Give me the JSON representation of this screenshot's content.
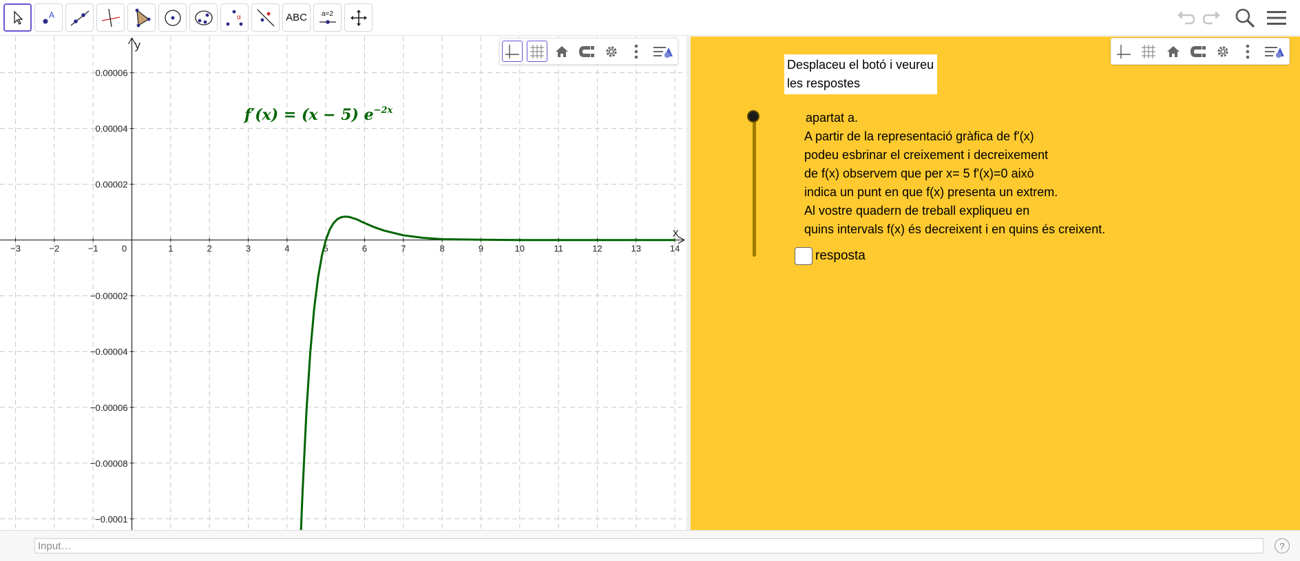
{
  "toolbar": {
    "tools": [
      {
        "name": "move-tool",
        "icon": "arrow-cursor-icon",
        "active": true
      },
      {
        "name": "point-tool",
        "icon": "point-icon"
      },
      {
        "name": "line-tool",
        "icon": "line-icon"
      },
      {
        "name": "perpendicular-line-tool",
        "icon": "perpendicular-icon"
      },
      {
        "name": "polygon-tool",
        "icon": "polygon-icon"
      },
      {
        "name": "circle-tool",
        "icon": "circle-icon"
      },
      {
        "name": "ellipse-tool",
        "icon": "ellipse-icon"
      },
      {
        "name": "angle-tool",
        "icon": "angle-icon"
      },
      {
        "name": "reflect-tool",
        "icon": "reflect-icon"
      },
      {
        "name": "text-tool",
        "icon": "text-icon",
        "label": "ABC"
      },
      {
        "name": "slider-tool",
        "icon": "slider-icon",
        "label": "a = 2"
      },
      {
        "name": "move-graphics-tool",
        "icon": "move-graphics-icon"
      }
    ],
    "right": {
      "undo_icon": "undo-icon",
      "redo_icon": "redo-icon",
      "search_icon": "search-icon",
      "menu_icon": "hamburger-menu-icon"
    }
  },
  "graphics": {
    "formula": {
      "lhs": "f′(x) = (x − 5) e",
      "exponent": "−2x"
    },
    "axis_labels": {
      "x": "x",
      "y": "y"
    },
    "x_ticks": [
      "−3",
      "−2",
      "−1",
      "0",
      "1",
      "2",
      "3",
      "4",
      "5",
      "6",
      "7",
      "8",
      "9",
      "10",
      "11",
      "12",
      "13",
      "14"
    ],
    "y_ticks": [
      "0.00006",
      "0.00004",
      "0.00002",
      "−0.00002",
      "−0.00004",
      "−0.00006",
      "−0.00008",
      "−0.0001"
    ],
    "curve_color": "#006400",
    "style_bar": [
      "axes-toggle-icon",
      "grid-toggle-icon",
      "home-icon",
      "magnet-icon",
      "settings-gear-icon",
      "more-vertical-icon",
      "style-bar-menu-icon"
    ]
  },
  "chart_data": {
    "type": "line",
    "function": "f'(x) = (x − 5) e^(−2x)",
    "xlim": [
      -3.4,
      14.3
    ],
    "ylim": [
      -0.000104,
      7.3e-05
    ],
    "x_ticks": [
      -3,
      -2,
      -1,
      0,
      1,
      2,
      3,
      4,
      5,
      6,
      7,
      8,
      9,
      10,
      11,
      12,
      13,
      14
    ],
    "y_ticks": [
      6e-05,
      4e-05,
      2e-05,
      -2e-05,
      -4e-05,
      -6e-05,
      -8e-05,
      -0.0001
    ],
    "grid": true,
    "series": [
      {
        "color": "#006400",
        "x": [
          4.35,
          4.4,
          4.5,
          4.6,
          4.7,
          4.8,
          4.9,
          5.0,
          5.1,
          5.2,
          5.3,
          5.4,
          5.5,
          5.6,
          5.8,
          6.0,
          6.25,
          6.5,
          7.0,
          7.5,
          8.0,
          9.0,
          10.0,
          11.0,
          12.0,
          13.0,
          14.0
        ],
        "y": [
          -0.000108,
          -9.04e-05,
          -6.17e-05,
          -4.03e-05,
          -2.45e-05,
          -1.35e-05,
          -5.6e-06,
          0.0,
          3.7e-06,
          6.1e-06,
          7.5e-06,
          8.2e-06,
          8.4e-06,
          8.3e-06,
          7.4e-06,
          6.1e-06,
          4.6e-06,
          3.4e-06,
          1.7e-06,
          8e-07,
          3e-07,
          1e-07,
          0.0,
          0.0,
          0.0,
          0.0,
          0.0
        ]
      }
    ]
  },
  "graphics2": {
    "background": "#ffca2f",
    "instruction_lines": [
      "Desplaceu el botó i veureu",
      "les respostes"
    ],
    "answer_title": "apartat a.",
    "answer_lines": [
      "A partir de la representació gràfica de f'(x)",
      "podeu esbrinar el creixement i decreixement",
      "de  f(x) observem que per x= 5 f'(x)=0 això",
      "indica un punt en que f(x) presenta un extrem.",
      "Al vostre quadern de treball expliqueu en",
      "quins intervals f(x) és decreixent i en quins és creixent."
    ],
    "checkbox_label": "resposta",
    "checkbox_checked": false,
    "slider_value": 0
  },
  "inputbar": {
    "placeholder": "Input…",
    "help_label": "?"
  }
}
